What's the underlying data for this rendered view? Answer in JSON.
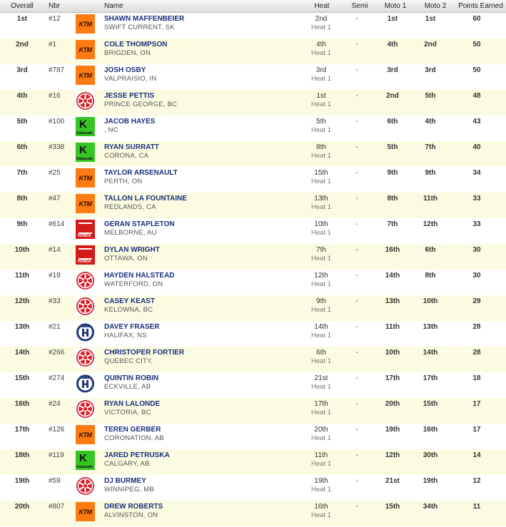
{
  "headers": {
    "overall": "Overall",
    "nbr": "Nbr",
    "name": "Name",
    "heat": "Heat",
    "semi": "Semi",
    "moto1": "Moto 1",
    "moto2": "Moto 2",
    "points": "Points Earned"
  },
  "rows": [
    {
      "overall": "1st",
      "nbr": "#12",
      "brand": "ktm",
      "name": "SHAWN MAFFENBEIER",
      "city": "SWIFT CURRENT, SK",
      "heat": "2nd",
      "heat_sub": "Heat 1",
      "semi": "-",
      "moto1": "1st",
      "moto2": "1st",
      "points": "60"
    },
    {
      "overall": "2nd",
      "nbr": "#1",
      "brand": "ktm",
      "name": "COLE THOMPSON",
      "city": "BRIGDEN, ON",
      "heat": "4th",
      "heat_sub": "Heat 1",
      "semi": "-",
      "moto1": "4th",
      "moto2": "2nd",
      "points": "50"
    },
    {
      "overall": "3rd",
      "nbr": "#787",
      "brand": "ktm",
      "name": "JOSH OSBY",
      "city": "VALPRAISIO, IN",
      "heat": "3rd",
      "heat_sub": "Heat 1",
      "semi": "-",
      "moto1": "3rd",
      "moto2": "3rd",
      "points": "50"
    },
    {
      "overall": "4th",
      "nbr": "#16",
      "brand": "yamaha",
      "name": "JESSE PETTIS",
      "city": "PRINCE GEORGE, BC",
      "heat": "1st",
      "heat_sub": "Heat 1",
      "semi": "-",
      "moto1": "2nd",
      "moto2": "5th",
      "points": "48"
    },
    {
      "overall": "5th",
      "nbr": "#100",
      "brand": "kawasaki",
      "name": "JACOB HAYES",
      "city": ", NC",
      "heat": "5th",
      "heat_sub": "Heat 1",
      "semi": "-",
      "moto1": "6th",
      "moto2": "4th",
      "points": "43"
    },
    {
      "overall": "6th",
      "nbr": "#338",
      "brand": "kawasaki",
      "name": "RYAN SURRATT",
      "city": "CORONA, CA",
      "heat": "8th",
      "heat_sub": "Heat 1",
      "semi": "-",
      "moto1": "5th",
      "moto2": "7th",
      "points": "40"
    },
    {
      "overall": "7th",
      "nbr": "#25",
      "brand": "ktm",
      "name": "TAYLOR ARSENAULT",
      "city": "PERTH, ON",
      "heat": "15th",
      "heat_sub": "Heat 1",
      "semi": "-",
      "moto1": "9th",
      "moto2": "9th",
      "points": "34"
    },
    {
      "overall": "8th",
      "nbr": "#47",
      "brand": "ktm",
      "name": "TALLON LA FOUNTAINE",
      "city": "REDLANDS, CA",
      "heat": "13th",
      "heat_sub": "Heat 1",
      "semi": "-",
      "moto1": "8th",
      "moto2": "11th",
      "points": "33"
    },
    {
      "overall": "9th",
      "nbr": "#614",
      "brand": "honda",
      "name": "GERAN STAPLETON",
      "city": "MELBORNE, AU",
      "heat": "10th",
      "heat_sub": "Heat 1",
      "semi": "-",
      "moto1": "7th",
      "moto2": "12th",
      "points": "33"
    },
    {
      "overall": "10th",
      "nbr": "#14",
      "brand": "honda",
      "name": "DYLAN WRIGHT",
      "city": "OTTAWA, ON",
      "heat": "7th",
      "heat_sub": "Heat 1",
      "semi": "-",
      "moto1": "16th",
      "moto2": "6th",
      "points": "30"
    },
    {
      "overall": "11th",
      "nbr": "#19",
      "brand": "yamaha",
      "name": "HAYDEN HALSTEAD",
      "city": "WATERFORD, ON",
      "heat": "12th",
      "heat_sub": "Heat 1",
      "semi": "-",
      "moto1": "14th",
      "moto2": "8th",
      "points": "30"
    },
    {
      "overall": "12th",
      "nbr": "#33",
      "brand": "yamaha",
      "name": "CASEY KEAST",
      "city": "KELOWNA, BC",
      "heat": "9th",
      "heat_sub": "Heat 1",
      "semi": "-",
      "moto1": "13th",
      "moto2": "10th",
      "points": "29"
    },
    {
      "overall": "13th",
      "nbr": "#21",
      "brand": "husqvarna",
      "name": "DAVEY FRASER",
      "city": "HALIFAX, NS",
      "heat": "14th",
      "heat_sub": "Heat 1",
      "semi": "-",
      "moto1": "11th",
      "moto2": "13th",
      "points": "28"
    },
    {
      "overall": "14th",
      "nbr": "#266",
      "brand": "yamaha",
      "name": "CHRISTOPER FORTIER",
      "city": "QUEBEC CITY,",
      "heat": "6th",
      "heat_sub": "Heat 1",
      "semi": "-",
      "moto1": "10th",
      "moto2": "14th",
      "points": "28"
    },
    {
      "overall": "15th",
      "nbr": "#274",
      "brand": "husqvarna",
      "name": "QUINTIN ROBIN",
      "city": "ECKVILLE, AB",
      "heat": "21st",
      "heat_sub": "Heat 1",
      "semi": "-",
      "moto1": "17th",
      "moto2": "17th",
      "points": "18"
    },
    {
      "overall": "16th",
      "nbr": "#24",
      "brand": "yamaha",
      "name": "RYAN LALONDE",
      "city": "VICTORIA, BC",
      "heat": "17th",
      "heat_sub": "Heat 1",
      "semi": "-",
      "moto1": "20th",
      "moto2": "15th",
      "points": "17"
    },
    {
      "overall": "17th",
      "nbr": "#126",
      "brand": "ktm",
      "name": "TEREN GERBER",
      "city": "CORONATION, AB",
      "heat": "20th",
      "heat_sub": "Heat 1",
      "semi": "-",
      "moto1": "19th",
      "moto2": "16th",
      "points": "17"
    },
    {
      "overall": "18th",
      "nbr": "#119",
      "brand": "kawasaki",
      "name": "JARED PETRUSKA",
      "city": "CALGARY, AB",
      "heat": "11th",
      "heat_sub": "Heat 1",
      "semi": "-",
      "moto1": "12th",
      "moto2": "30th",
      "points": "14"
    },
    {
      "overall": "19th",
      "nbr": "#59",
      "brand": "yamaha",
      "name": "DJ BURMEY",
      "city": "WINNIPEG, MB",
      "heat": "19th",
      "heat_sub": "Heat 1",
      "semi": "-",
      "moto1": "21st",
      "moto2": "19th",
      "points": "12"
    },
    {
      "overall": "20th",
      "nbr": "#807",
      "brand": "ktm",
      "name": "DREW ROBERTS",
      "city": "ALVINSTON, ON",
      "heat": "16th",
      "heat_sub": "Heat 1",
      "semi": "-",
      "moto1": "15th",
      "moto2": "34th",
      "points": "11"
    }
  ],
  "brand_logos": {
    "ktm": {
      "text": "KTM",
      "color": "#ff7a12"
    },
    "kawasaki": {
      "text": "K",
      "sub": "Kawasaki",
      "color": "#35c625"
    },
    "honda": {
      "sub": "HONDA",
      "color": "#d21a1a"
    },
    "yamaha": {
      "color": "#d22030"
    },
    "husqvarna": {
      "color": "#1f3a7a"
    }
  }
}
